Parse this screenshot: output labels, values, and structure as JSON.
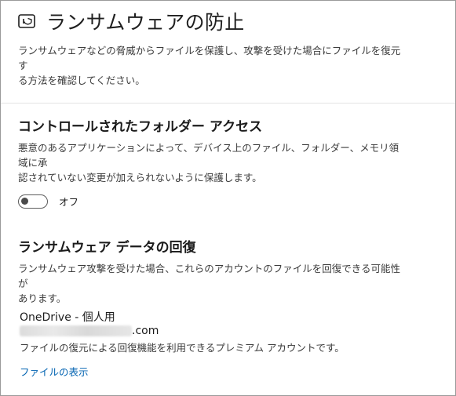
{
  "page": {
    "title": "ランサムウェアの防止",
    "title_icon": "shield-window-icon",
    "description_line1": "ランサムウェアなどの脅威からファイルを保護し、攻撃を受けた場合にファイルを復元す",
    "description_line2": "る方法を確認してください。"
  },
  "cfa": {
    "title": "コントロールされたフォルダー アクセス",
    "desc_line1": "悪意のあるアプリケーションによって、デバイス上のファイル、フォルダー、メモリ領域に承",
    "desc_line2": "認されていない変更が加えられないように保護します。",
    "toggle_state": "off",
    "toggle_label": "オフ"
  },
  "recovery": {
    "title": "ランサムウェア データの回復",
    "desc_line1": "ランサムウェア攻撃を受けた場合、これらのアカウントのファイルを回復できる可能性が",
    "desc_line2": "あります。",
    "account": {
      "name": "OneDrive - 個人用",
      "email_suffix": ".com",
      "description": "ファイルの復元による回復機能を利用できるプレミアム アカウントです。"
    },
    "link": "ファイルの表示"
  },
  "colors": {
    "link": "#0062b1",
    "text": "#1b1b1b",
    "secondary_text": "#3b3b3b"
  }
}
